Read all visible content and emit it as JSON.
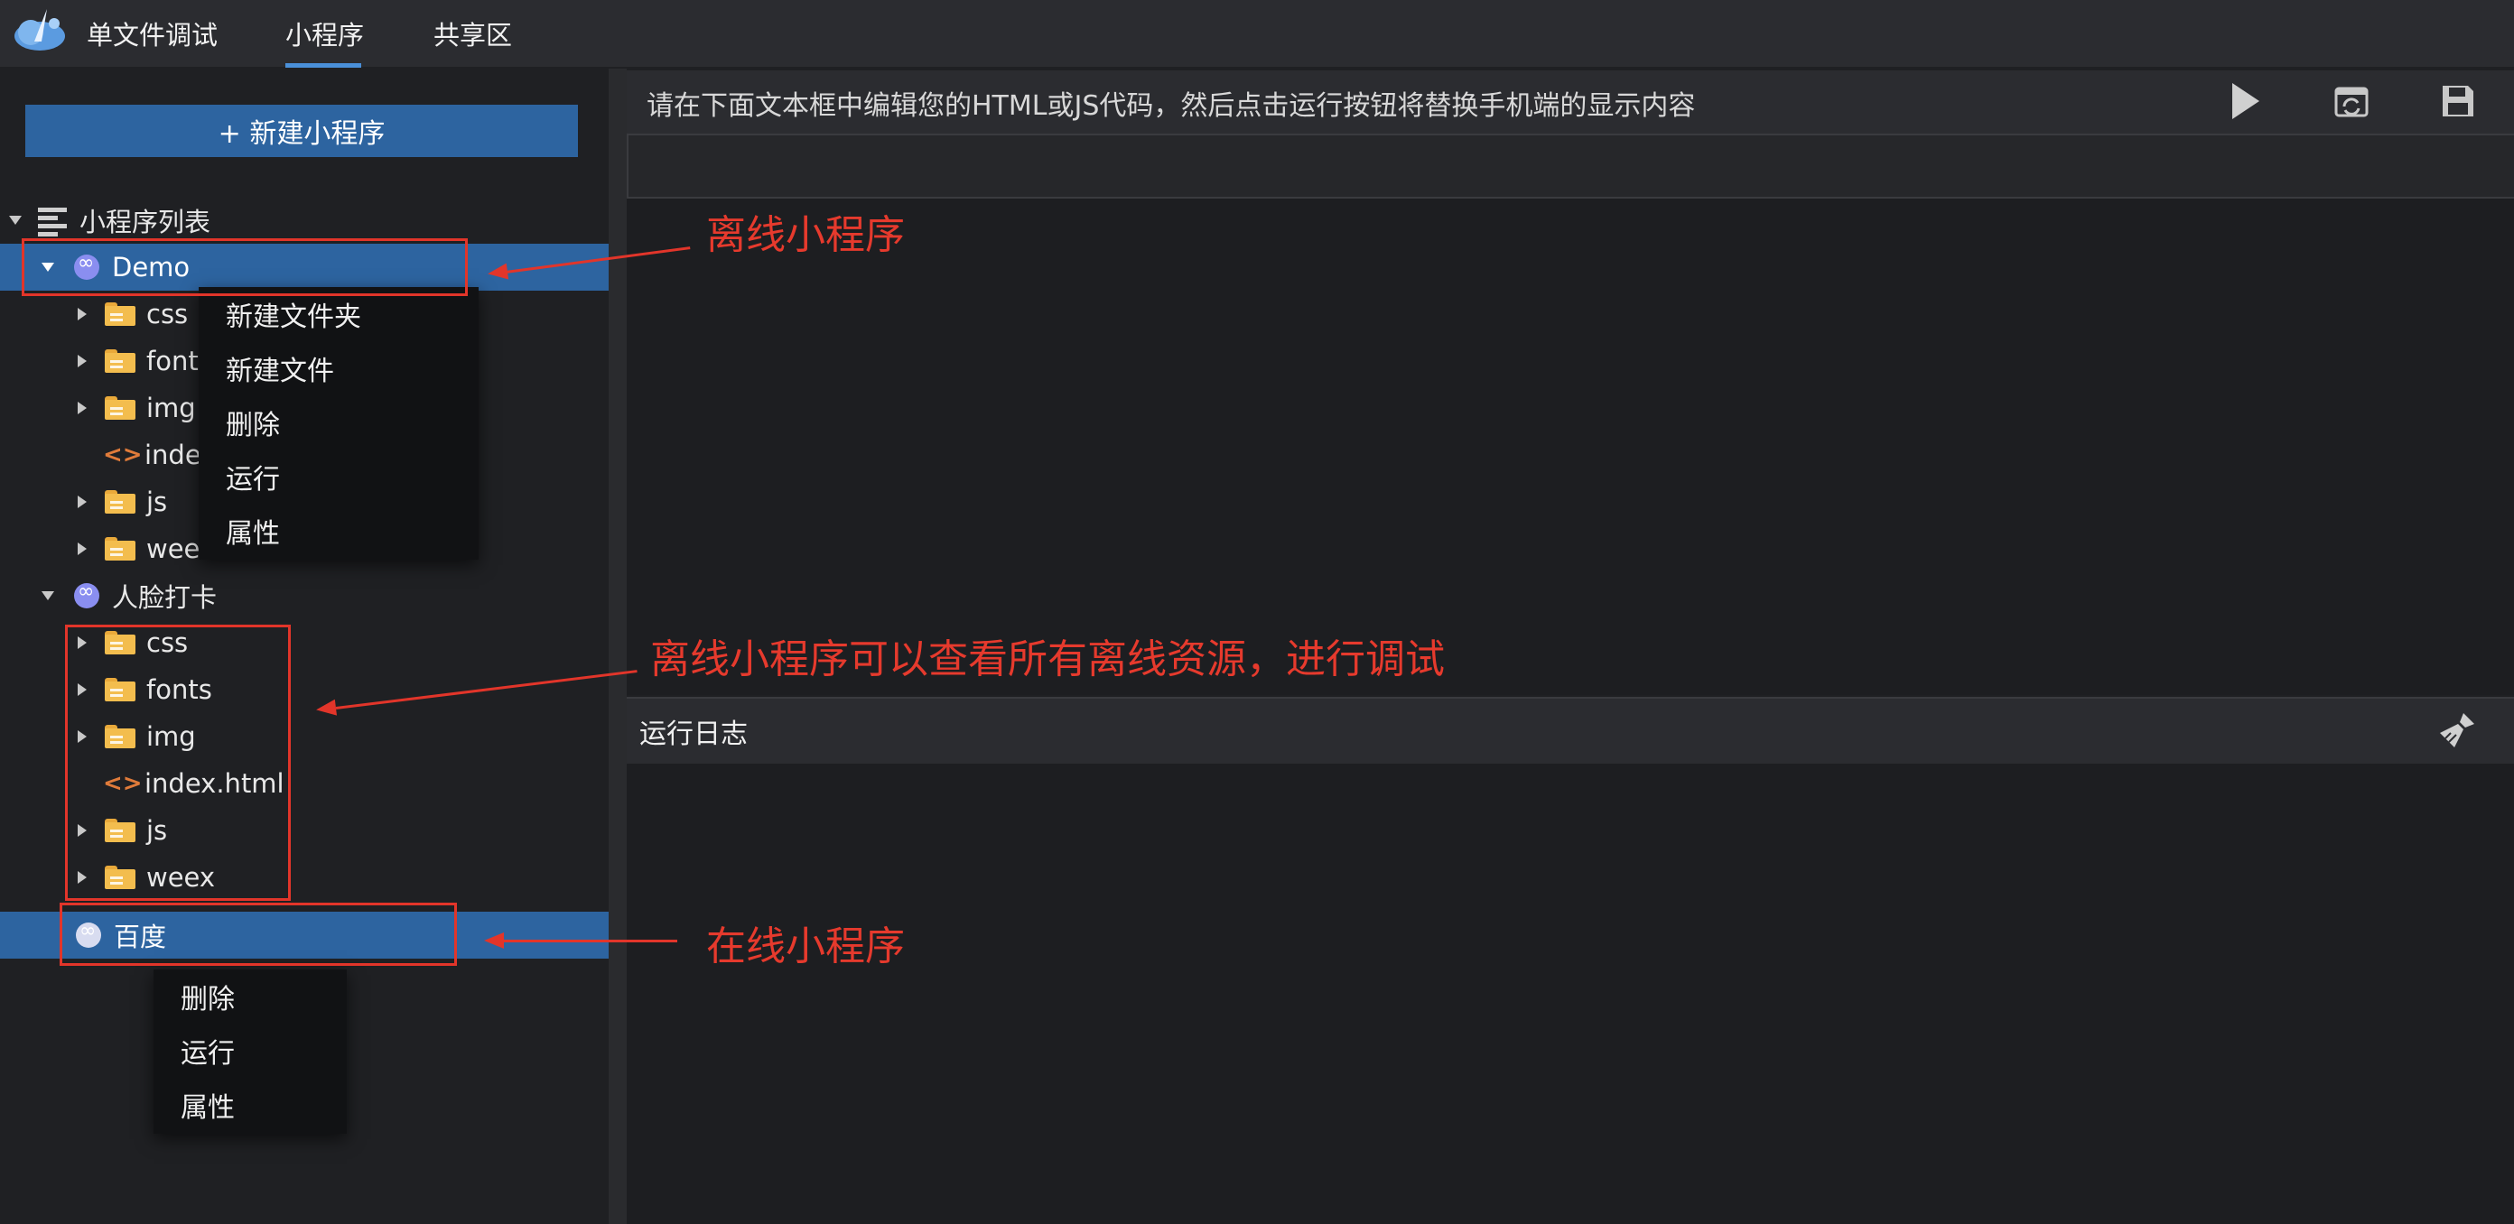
{
  "nav": {
    "tabs": [
      "单文件调试",
      "小程序",
      "共享区"
    ],
    "active_index": 1
  },
  "sidebar": {
    "new_button": "+ 新建小程序",
    "list_title": "小程序列表",
    "demo": {
      "name": "Demo",
      "children": [
        "css",
        "font",
        "img",
        "inde",
        "js",
        "wee"
      ]
    },
    "face": {
      "name": "人脸打卡",
      "children": [
        "css",
        "fonts",
        "img",
        "index.html",
        "js",
        "weex"
      ]
    },
    "online": {
      "name": "百度"
    }
  },
  "context_menu_offline": {
    "items": [
      "新建文件夹",
      "新建文件",
      "删除",
      "运行",
      "属性"
    ]
  },
  "context_menu_online": {
    "items": [
      "删除",
      "运行",
      "属性"
    ]
  },
  "editor": {
    "hint": "请在下面文本框中编辑您的HTML或JS代码，然后点击运行按钮将替换手机端的显示内容"
  },
  "log": {
    "title": "运行日志"
  },
  "annotations": {
    "offline": "离线小程序",
    "resources": "离线小程序可以查看所有离线资源，进行调试",
    "online": "在线小程序"
  },
  "colors": {
    "accent": "#2d64a0",
    "annotation": "#e2352a",
    "folder": "#f3bd4e"
  }
}
